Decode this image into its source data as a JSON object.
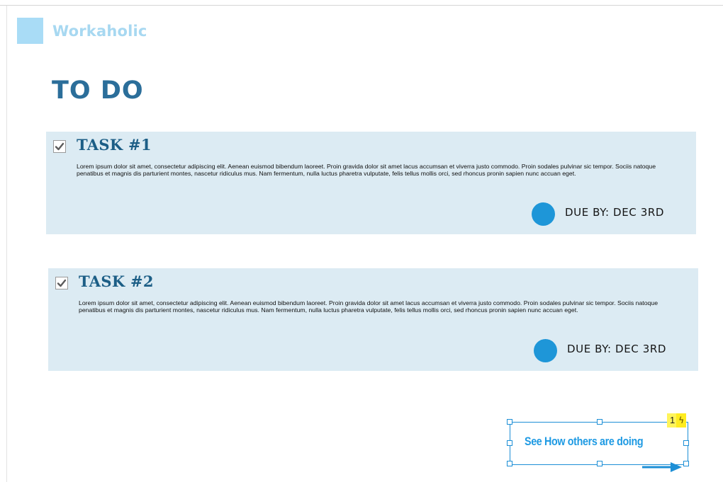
{
  "brand": {
    "name": "Workaholic"
  },
  "page": {
    "title": "TO DO"
  },
  "tasks": [
    {
      "title": "TASK #1",
      "checked": true,
      "description": "Lorem ipsum dolor sit amet, consectetur adipiscing elit. Aenean euismod bibendum laoreet. Proin gravida dolor sit amet lacus accumsan et viverra justo commodo. Proin sodales pulvinar sic tempor. Sociis natoque penatibus et magnis dis parturient montes, nascetur ridiculus mus. Nam fermentum, nulla luctus pharetra vulputate, felis tellus mollis orci, sed rhoncus pronin sapien nunc accuan eget.",
      "due": "DUE BY: DEC 3RD"
    },
    {
      "title": "TASK #2",
      "checked": true,
      "description": "Lorem ipsum dolor sit amet, consectetur adipiscing elit. Aenean euismod bibendum laoreet. Proin gravida dolor sit amet lacus accumsan et viverra justo commodo. Proin sodales pulvinar sic tempor. Sociis natoque penatibus et magnis dis parturient montes, nascetur ridiculus mus. Nam fermentum, nulla luctus pharetra vulputate, felis tellus mollis orci, sed rhoncus pronin sapien nunc accuan eget.",
      "due": "DUE BY: DEC 3RD"
    }
  ],
  "cta": {
    "label": "See How others are doing",
    "badge_count": "1",
    "badge_icon": "lightning-icon"
  },
  "colors": {
    "accent": "#1e96d8",
    "title": "#2b6e9a",
    "card_bg": "#dcebf3",
    "logo": "#a9dcf6",
    "badge": "#ffec1f"
  }
}
